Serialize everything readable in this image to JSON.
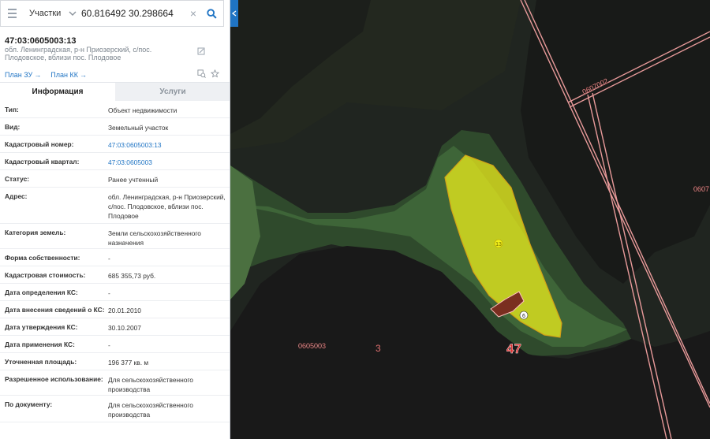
{
  "search": {
    "type": "Участки",
    "value": "60.816492 30.298664"
  },
  "parcel": {
    "number": "47:03:0605003:13",
    "address": "обл. Ленинградская, р-н Приозерский, с/пос. Плодовское, вблизи пос. Плодовое"
  },
  "links": {
    "plan_zu": "План ЗУ",
    "plan_kk": "План КК",
    "arrow": "→"
  },
  "tabs": [
    {
      "label": "Информация"
    },
    {
      "label": "Услуги"
    }
  ],
  "info": [
    {
      "key": "Тип:",
      "value": "Объект недвижимости"
    },
    {
      "key": "Вид:",
      "value": "Земельный участок"
    },
    {
      "key": "Кадастровый номер:",
      "value": "47:03:0605003:13"
    },
    {
      "key": "Кадастровый квартал:",
      "value": "47:03:0605003"
    },
    {
      "key": "Статус:",
      "value": "Ранее учтенный"
    },
    {
      "key": "Адрес:",
      "value": "обл. Ленинградская, р-н Приозерский, с/пос. Плодовское, вблизи пос. Плодовое"
    },
    {
      "key": "Категория земель:",
      "value": "Земли сельскохозяйственного назначения"
    },
    {
      "key": "Форма собственности:",
      "value": "-"
    },
    {
      "key": "Кадастровая стоимость:",
      "value": "685 355,73 руб."
    },
    {
      "key": "Дата определения КС:",
      "value": "-"
    },
    {
      "key": "Дата внесения сведений о КС:",
      "value": "20.01.2010"
    },
    {
      "key": "Дата утверждения КС:",
      "value": "30.10.2007"
    },
    {
      "key": "Дата применения КС:",
      "value": "-"
    },
    {
      "key": "Уточненная площадь:",
      "value": "196 377 кв. м"
    },
    {
      "key": "Разрешенное использование:",
      "value": "Для сельскохозяйственного производства"
    },
    {
      "key": "По документу:",
      "value": "Для сельскохозяйственного производства"
    }
  ],
  "map": {
    "labels": {
      "quarter_west": "0605003",
      "quarter_north": "0607002",
      "quarter_east": "0607",
      "district_small": "3",
      "district_big": "47",
      "parcel_main": "13",
      "parcel_small": "6"
    }
  },
  "colors": {
    "accent": "#1f74c4",
    "parcel_fill": "#f2f21a",
    "parcel_border": "#d4a017",
    "boundary": "#e89a9a"
  }
}
